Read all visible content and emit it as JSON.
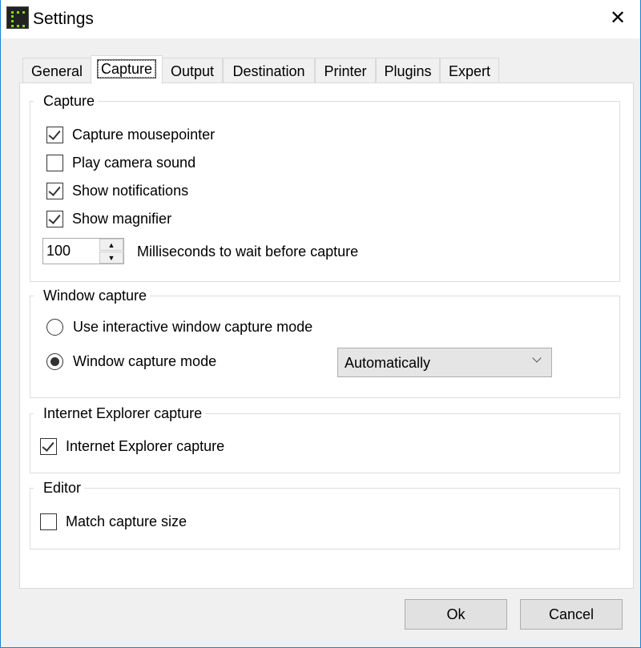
{
  "window": {
    "title": "Settings",
    "close": "✕"
  },
  "tabs": [
    {
      "label": "General"
    },
    {
      "label": "Capture",
      "active": true
    },
    {
      "label": "Output"
    },
    {
      "label": "Destination"
    },
    {
      "label": "Printer"
    },
    {
      "label": "Plugins"
    },
    {
      "label": "Expert"
    }
  ],
  "capture": {
    "title": "Capture",
    "options": [
      {
        "label": "Capture mousepointer",
        "checked": true
      },
      {
        "label": "Play camera sound",
        "checked": false
      },
      {
        "label": "Show notifications",
        "checked": true
      },
      {
        "label": "Show magnifier",
        "checked": true
      }
    ],
    "delay_value": "100",
    "delay_label": "Milliseconds to wait before capture"
  },
  "window_capture": {
    "title": "Window capture",
    "interactive_label": "Use interactive window capture mode",
    "mode_label": "Window capture mode",
    "mode_value": "Automatically",
    "selected": "mode"
  },
  "ie": {
    "title": "Internet Explorer capture",
    "option": "Internet Explorer capture",
    "checked": true
  },
  "editor": {
    "title": "Editor",
    "option": "Match capture size",
    "checked": false
  },
  "buttons": {
    "ok": "Ok",
    "cancel": "Cancel"
  }
}
